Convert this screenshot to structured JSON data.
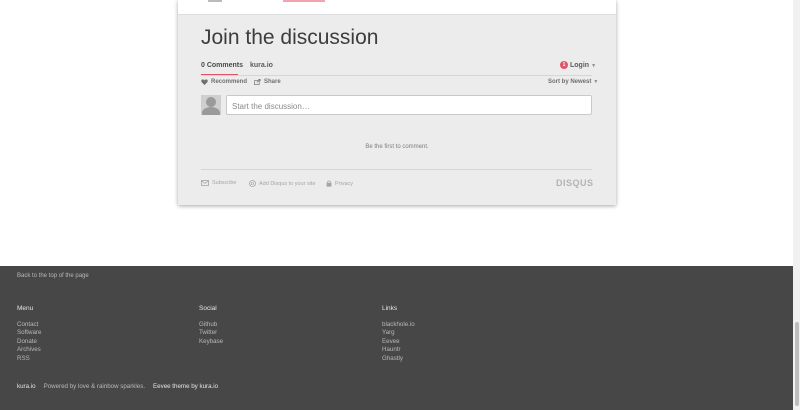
{
  "disqus": {
    "title": "Join the discussion",
    "tabs": {
      "comments": "0 Comments",
      "site": "kura.io"
    },
    "login": {
      "badge": "1",
      "label": "Login"
    },
    "actions": {
      "recommend": "Recommend",
      "share": "Share",
      "sort": "Sort by Newest"
    },
    "composer_placeholder": "Start the discussion…",
    "empty_message": "Be the first to comment.",
    "footer": {
      "subscribe": "Subscribe",
      "add_disqus": "Add Disqus to your site",
      "privacy": "Privacy",
      "logo": "DISQUS"
    },
    "accent_color": "#e05368"
  },
  "site_footer": {
    "back_to_top": "Back to the top of the page",
    "columns": [
      {
        "heading": "Menu",
        "items": [
          "Contact",
          "Software",
          "Donate",
          "Archives",
          "RSS"
        ]
      },
      {
        "heading": "Social",
        "items": [
          "Github",
          "Twitter",
          "Keybase"
        ]
      },
      {
        "heading": "Links",
        "items": [
          "blackhole.io",
          "Yarg",
          "Eevee",
          "Hauntr",
          "Ghastly"
        ]
      }
    ],
    "bottom": {
      "brand": "kura.io",
      "powered": "Powered by love & rainbow sparkles.",
      "theme": "Eevee theme by",
      "theme_author": "kura.io"
    },
    "background_color": "#474747"
  }
}
